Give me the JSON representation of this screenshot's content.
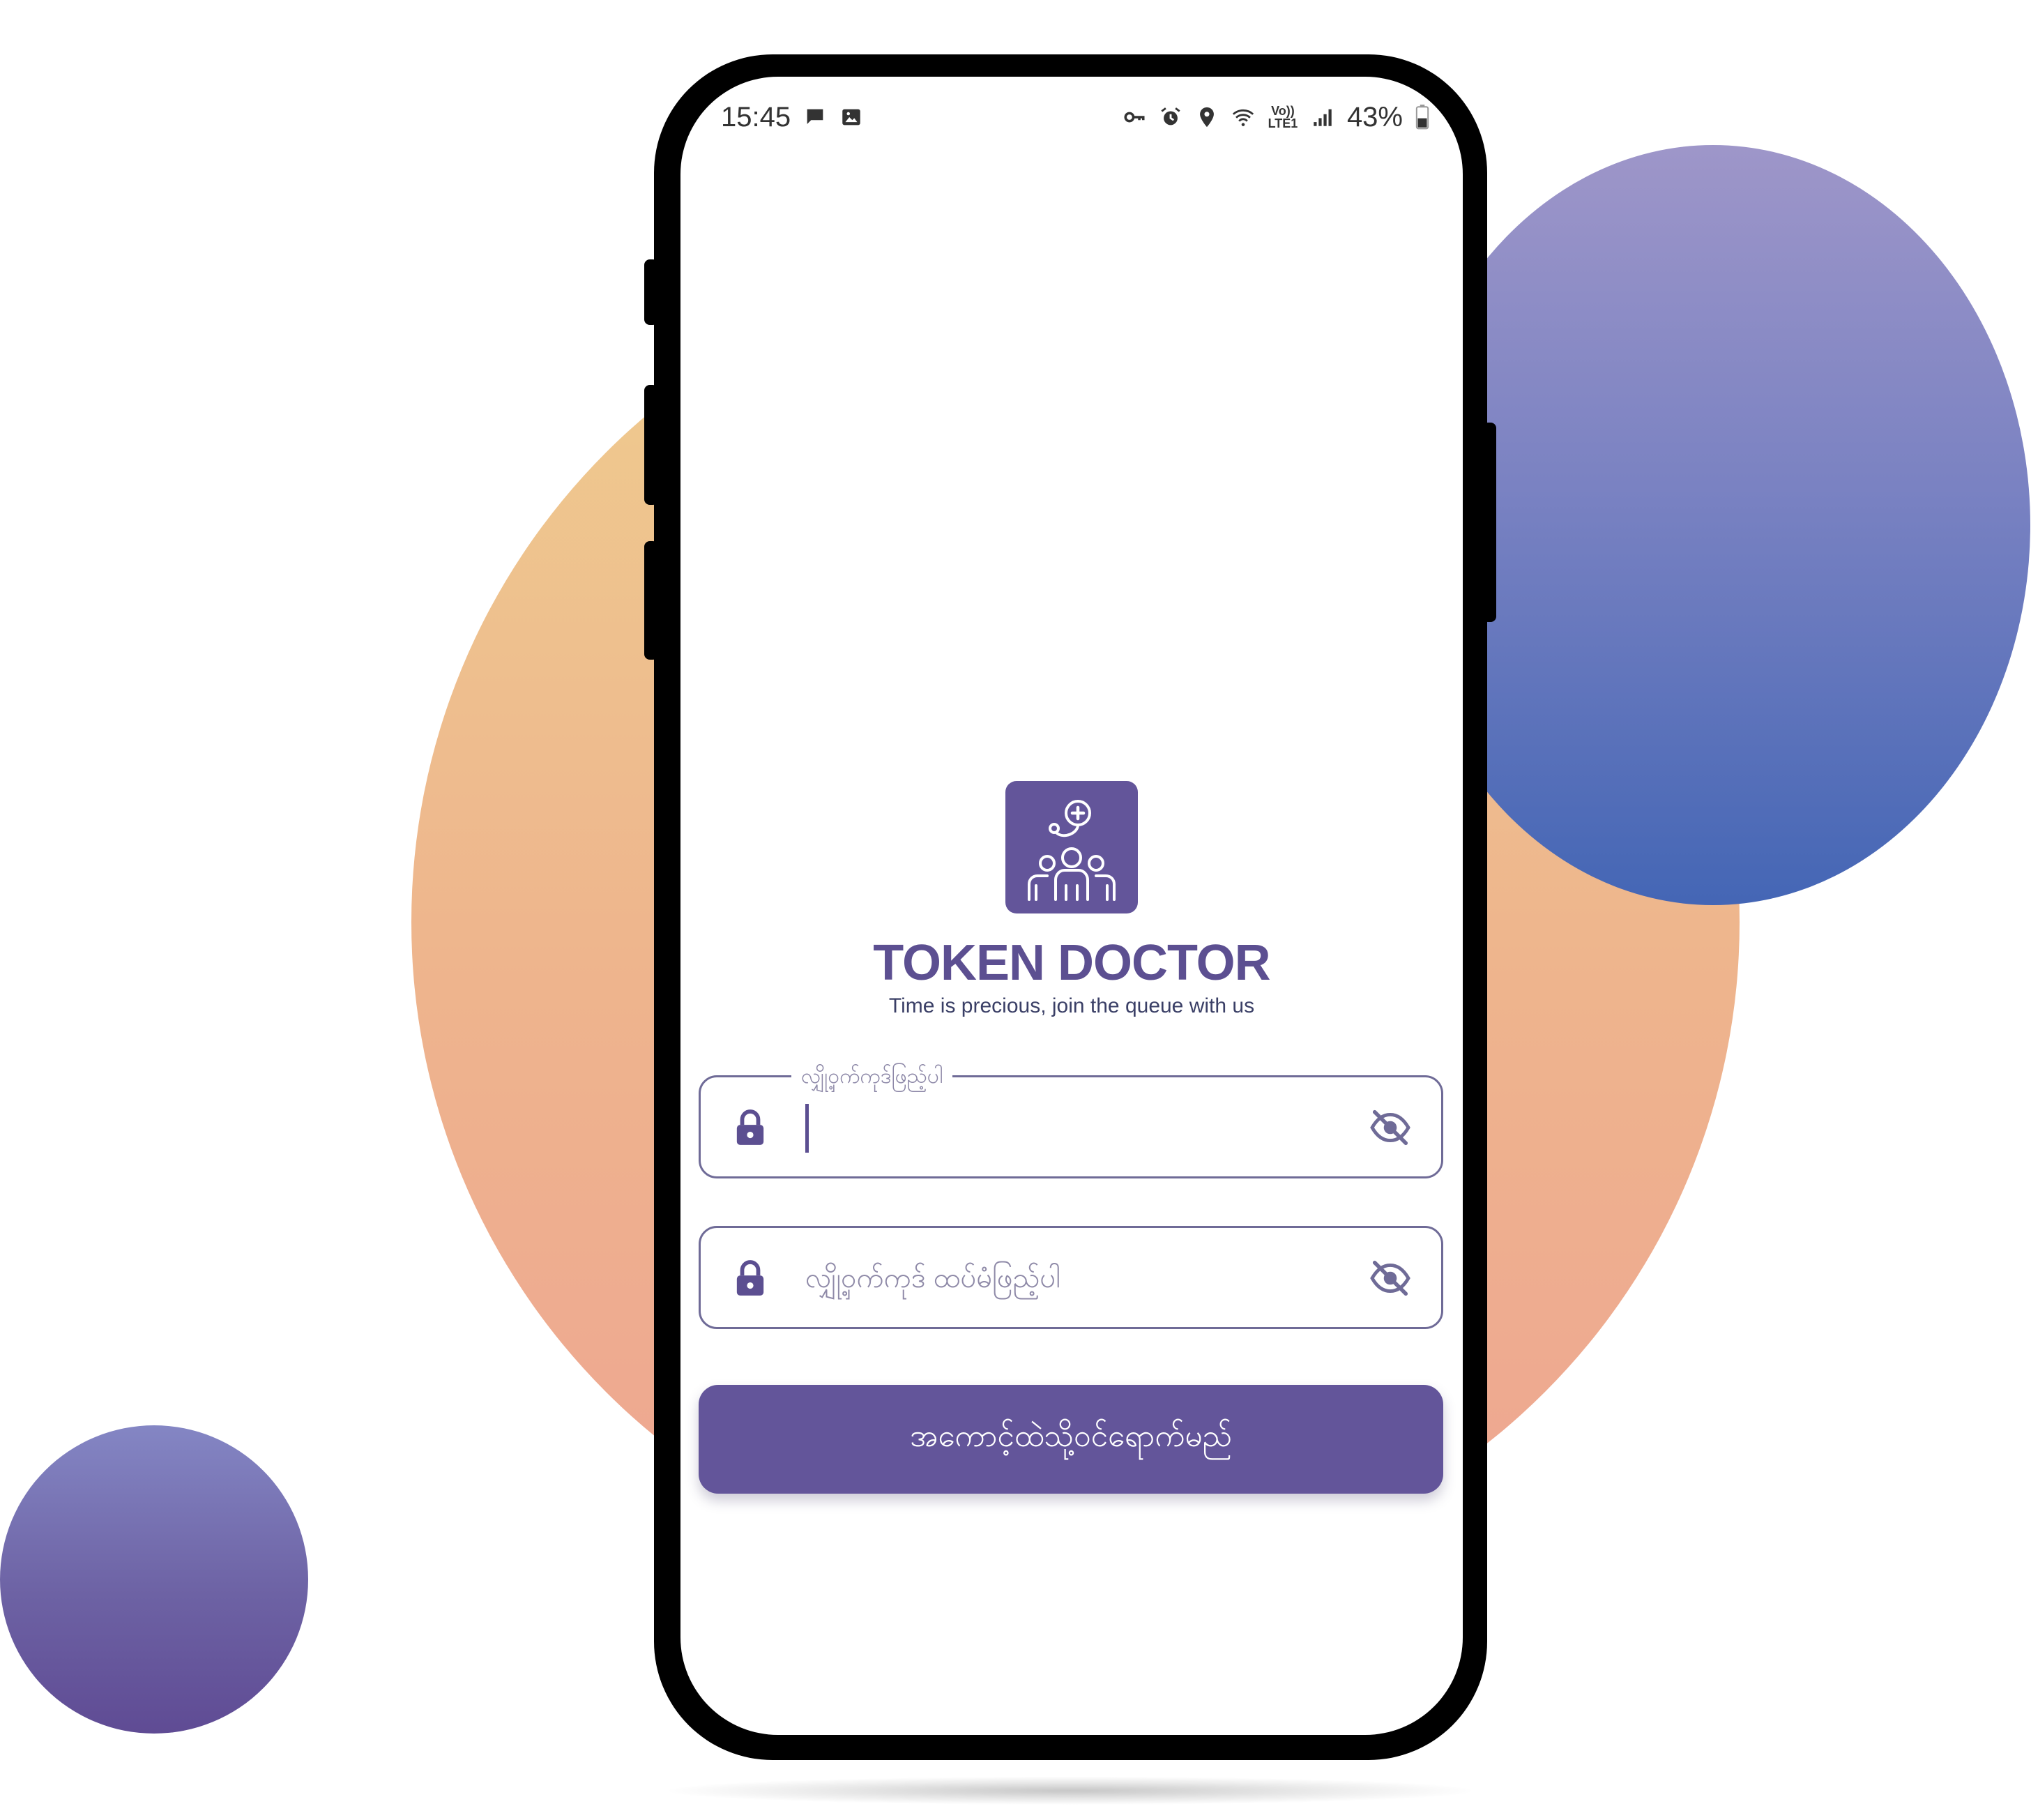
{
  "status_bar": {
    "time": "15:45",
    "network_label": "Vo)) LTE1",
    "battery": "43%",
    "left_icons": [
      "chat-bubble-icon",
      "image-icon"
    ],
    "right_icons": [
      "key-icon",
      "alarm-icon",
      "location-icon",
      "wifi-icon",
      "signal-icon",
      "battery-icon"
    ]
  },
  "app": {
    "name": "TOKEN DOCTOR",
    "tagline": "Time is precious, join the queue with us",
    "logo_icon": "doctor-stethoscope-people-icon"
  },
  "form": {
    "password_label": "လျှို့ဝှက်ကုဒ်ဖြည့်ပါ",
    "password_value": "",
    "confirm_placeholder": "လျှို့ဝှက်ကုဒ် ထပ်မံဖြည့်ပါ",
    "confirm_value": "",
    "submit_label": "အကောင့်ထဲသို့ဝင်ရောက်မည်"
  },
  "colors": {
    "brand": "#63559a",
    "field_border": "#6f6b97",
    "accent_orange": "#eeb48d",
    "accent_blue": "#4466b5"
  }
}
